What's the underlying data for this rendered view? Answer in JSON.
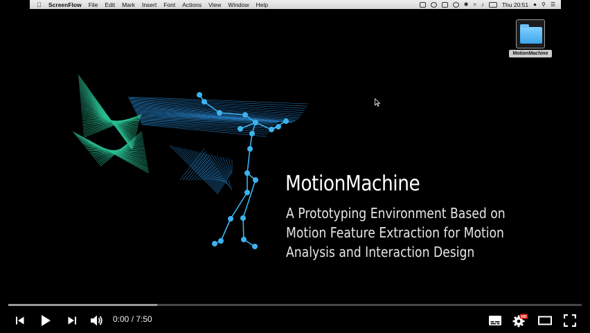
{
  "menubar": {
    "items": [
      "ScreenFlow",
      "File",
      "Edit",
      "Mark",
      "Insert",
      "Font",
      "Actions",
      "View",
      "Window",
      "Help"
    ],
    "clock": "Thu 20:51"
  },
  "desktop": {
    "folder_label": "MotionMachine"
  },
  "slide": {
    "title": "MotionMachine",
    "subtitle_lines": [
      "A Prototyping Environment Based on",
      "Motion Feature Extraction for Motion",
      "Analysis and Interaction Design"
    ]
  },
  "player": {
    "current_time": "0:00",
    "separator": " / ",
    "duration": "7:50",
    "played_fraction": 0.0,
    "loaded_fraction": 0.26,
    "hd_badge": "HD"
  },
  "colors": {
    "progress_played": "#ff0000",
    "art_green": "#2ed3a0",
    "art_blue": "#2a8bd6",
    "skeleton": "#3cb3ef"
  }
}
